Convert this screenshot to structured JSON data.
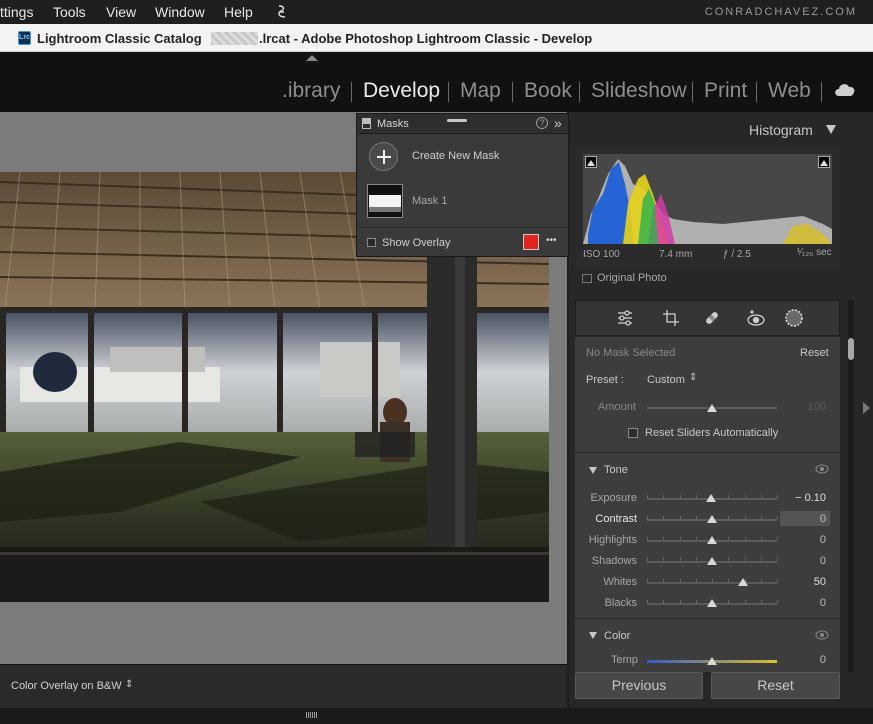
{
  "menubar": {
    "items": [
      "ttings",
      "Tools",
      "View",
      "Window",
      "Help"
    ],
    "credit": "CONRADCHAVEZ.COM"
  },
  "window": {
    "title_prefix": "Lightroom Classic Catalog",
    "title_suffix": ".lrcat - Adobe Photoshop Lightroom Classic - Develop",
    "app_icon_text": "Lrc"
  },
  "modules": [
    "Library",
    "Develop",
    "Map",
    "Book",
    "Slideshow",
    "Print",
    "Web"
  ],
  "modules_visible": [
    ".ibrary",
    "Develop",
    "Map",
    "Book",
    "Slideshow",
    "Print",
    "Web"
  ],
  "active_module": "Develop",
  "masks_panel": {
    "title": "Masks",
    "help": "?",
    "collapse": "»",
    "create_new": "Create New Mask",
    "mask1": "Mask 1",
    "show_overlay": "Show Overlay",
    "overlay_color": "#e0261c",
    "more": "•••"
  },
  "histogram": {
    "title": "Histogram",
    "iso": "ISO 100",
    "focal": "7.4 mm",
    "aperture": "ƒ / 2.5",
    "shutter": "¹⁄₁₂₅ sec",
    "original_photo": "Original Photo"
  },
  "tools": [
    "edit-sliders-icon",
    "crop-icon",
    "healing-icon",
    "red-eye-icon",
    "masking-icon"
  ],
  "mask_settings": {
    "status": "No Mask Selected",
    "reset": "Reset",
    "preset_label": "Preset :",
    "preset_value": "Custom",
    "amount_label": "Amount",
    "amount_value": "100",
    "amount_level": 0.5,
    "reset_sliders": "Reset Sliders Automatically"
  },
  "tone": {
    "title": "Tone",
    "sliders": [
      {
        "label": "Exposure",
        "value": "− 0.10",
        "level": 0.49
      },
      {
        "label": "Contrast",
        "value": "0",
        "level": 0.5
      },
      {
        "label": "Highlights",
        "value": "0",
        "level": 0.5
      },
      {
        "label": "Shadows",
        "value": "0",
        "level": 0.5
      },
      {
        "label": "Whites",
        "value": "50",
        "level": 0.74
      },
      {
        "label": "Blacks",
        "value": "0",
        "level": 0.5
      }
    ]
  },
  "color": {
    "title": "Color",
    "temp_label": "Temp",
    "temp_value": "0"
  },
  "buttons": {
    "previous": "Previous",
    "reset": "Reset"
  },
  "bottom": {
    "overlay_mode": "Color Overlay on B&W"
  }
}
